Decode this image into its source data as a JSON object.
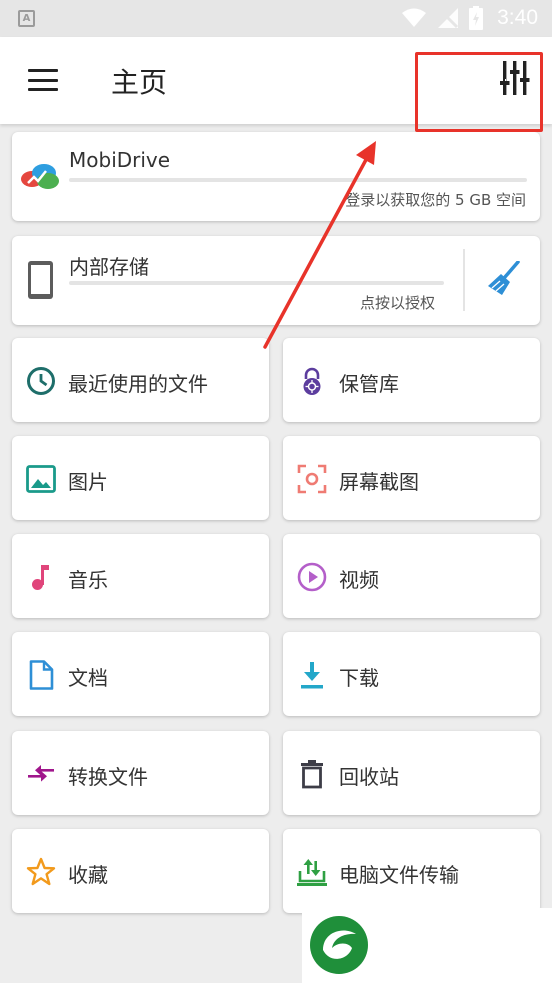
{
  "status_bar": {
    "time": "3:40"
  },
  "app_bar": {
    "title": "主页",
    "menu_icon": "hamburger-menu-icon",
    "action_icon": "tune-sliders-icon"
  },
  "mobidrive": {
    "name": "MobiDrive",
    "hint": "登录以获取您的 5 GB 空间"
  },
  "internal_storage": {
    "name": "内部存储",
    "hint": "点按以授权",
    "clean_icon": "broom-icon"
  },
  "tiles": [
    {
      "label": "最近使用的文件",
      "icon": "clock-icon",
      "color": "#1e6e6a"
    },
    {
      "label": "保管库",
      "icon": "lock-icon",
      "color": "#5c3d9e"
    },
    {
      "label": "图片",
      "icon": "image-icon",
      "color": "#1a9a8a"
    },
    {
      "label": "屏幕截图",
      "icon": "screenshot-icon",
      "color": "#ef7b73"
    },
    {
      "label": "音乐",
      "icon": "music-note-icon",
      "color": "#e0457b"
    },
    {
      "label": "视频",
      "icon": "play-circle-icon",
      "color": "#b45fc9"
    },
    {
      "label": "文档",
      "icon": "document-icon",
      "color": "#2e8fd6"
    },
    {
      "label": "下载",
      "icon": "download-icon",
      "color": "#23a7c9"
    },
    {
      "label": "转换文件",
      "icon": "convert-arrows-icon",
      "color": "#a0168c"
    },
    {
      "label": "回收站",
      "icon": "trash-icon",
      "color": "#3d3d47"
    },
    {
      "label": "收藏",
      "icon": "star-icon",
      "color": "#f29a1c"
    },
    {
      "label": "电脑文件传输",
      "icon": "pc-transfer-icon",
      "color": "#2fa043"
    }
  ]
}
